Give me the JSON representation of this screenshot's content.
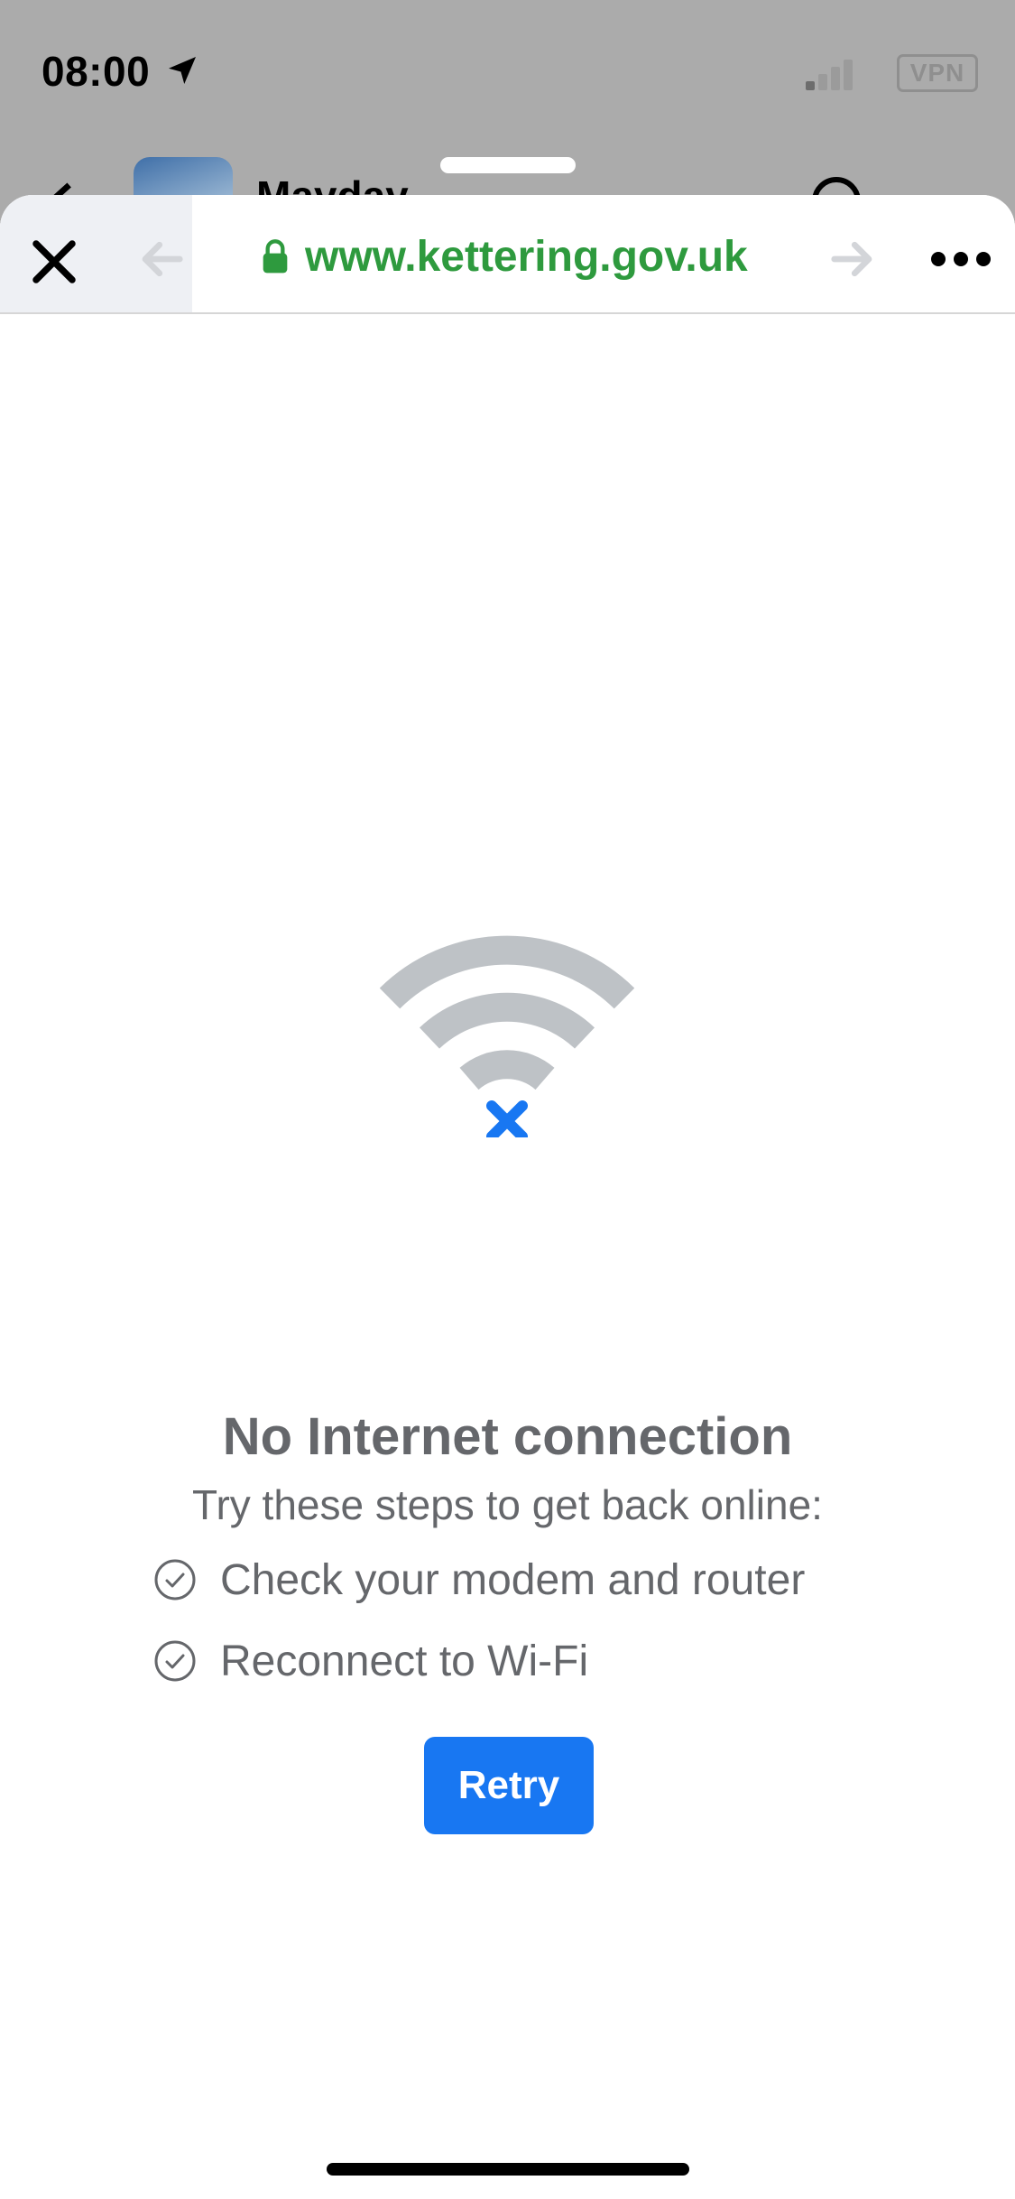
{
  "status_bar": {
    "time": "08:00",
    "vpn_label": "VPN",
    "location_icon": "location-arrow-icon",
    "signal_icon": "cellular-signal-icon"
  },
  "background_app": {
    "title": "Mayday"
  },
  "browser_toolbar": {
    "close_icon": "close-icon",
    "back_icon": "arrow-left-icon",
    "forward_icon": "arrow-right-icon",
    "more_icon": "more-horizontal-icon",
    "lock_icon": "lock-icon",
    "url": "www.kettering.gov.uk",
    "url_color": "#2e9a3e"
  },
  "offline_page": {
    "icon": "wifi-off-icon",
    "title": "No Internet connection",
    "subtitle": "Try these steps to get back online:",
    "steps": [
      {
        "icon": "check-circle-icon",
        "text": "Check your modem and router"
      },
      {
        "icon": "check-circle-icon",
        "text": "Reconnect to Wi-Fi"
      }
    ],
    "retry_label": "Retry",
    "accent_color": "#1877f2",
    "text_color": "#65676b"
  }
}
